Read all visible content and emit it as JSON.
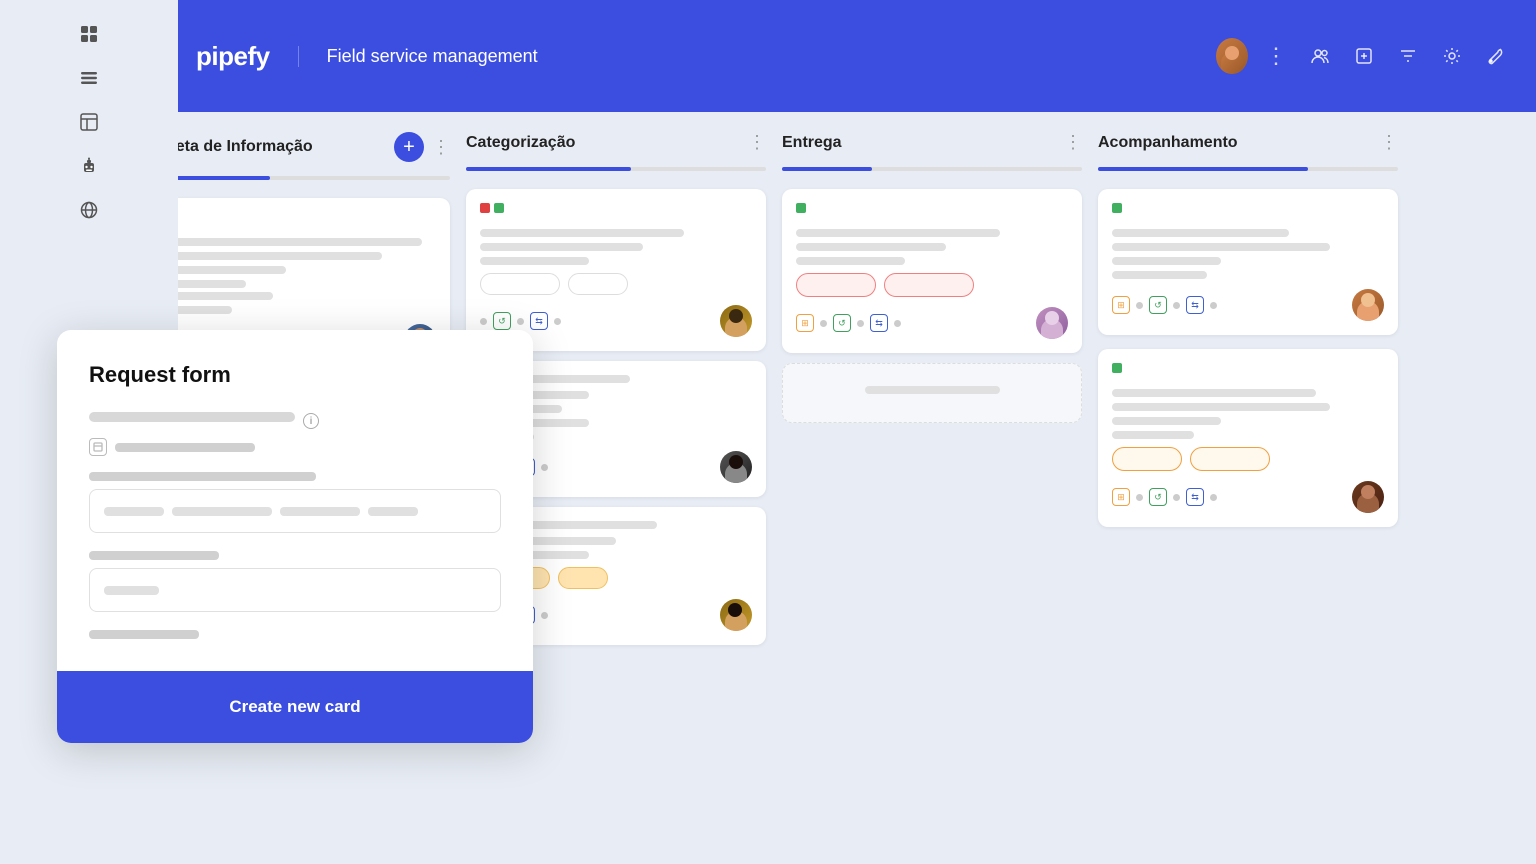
{
  "app": {
    "title": "Field service management",
    "logo": "pipefy"
  },
  "header": {
    "actions": [
      "add-user",
      "export",
      "filter",
      "settings",
      "wrench",
      "more",
      "avatar"
    ]
  },
  "sidebar": {
    "icons": [
      "grid",
      "list",
      "table",
      "robot",
      "globe"
    ]
  },
  "columns": [
    {
      "id": "col1",
      "title": "Coleta de Informação",
      "show_add": true,
      "progress": 40
    },
    {
      "id": "col2",
      "title": "Categorização",
      "show_add": false,
      "progress": 55
    },
    {
      "id": "col3",
      "title": "Entrega",
      "show_add": false,
      "progress": 30
    },
    {
      "id": "col4",
      "title": "Acompanhamento",
      "show_add": false,
      "progress": 70
    }
  ],
  "panel": {
    "title": "Request form",
    "field1_label": "",
    "field2_label": "",
    "input1_placeholders": [
      "",
      "",
      "",
      ""
    ],
    "input2_placeholder": "",
    "footer_btn": "Create new card"
  }
}
